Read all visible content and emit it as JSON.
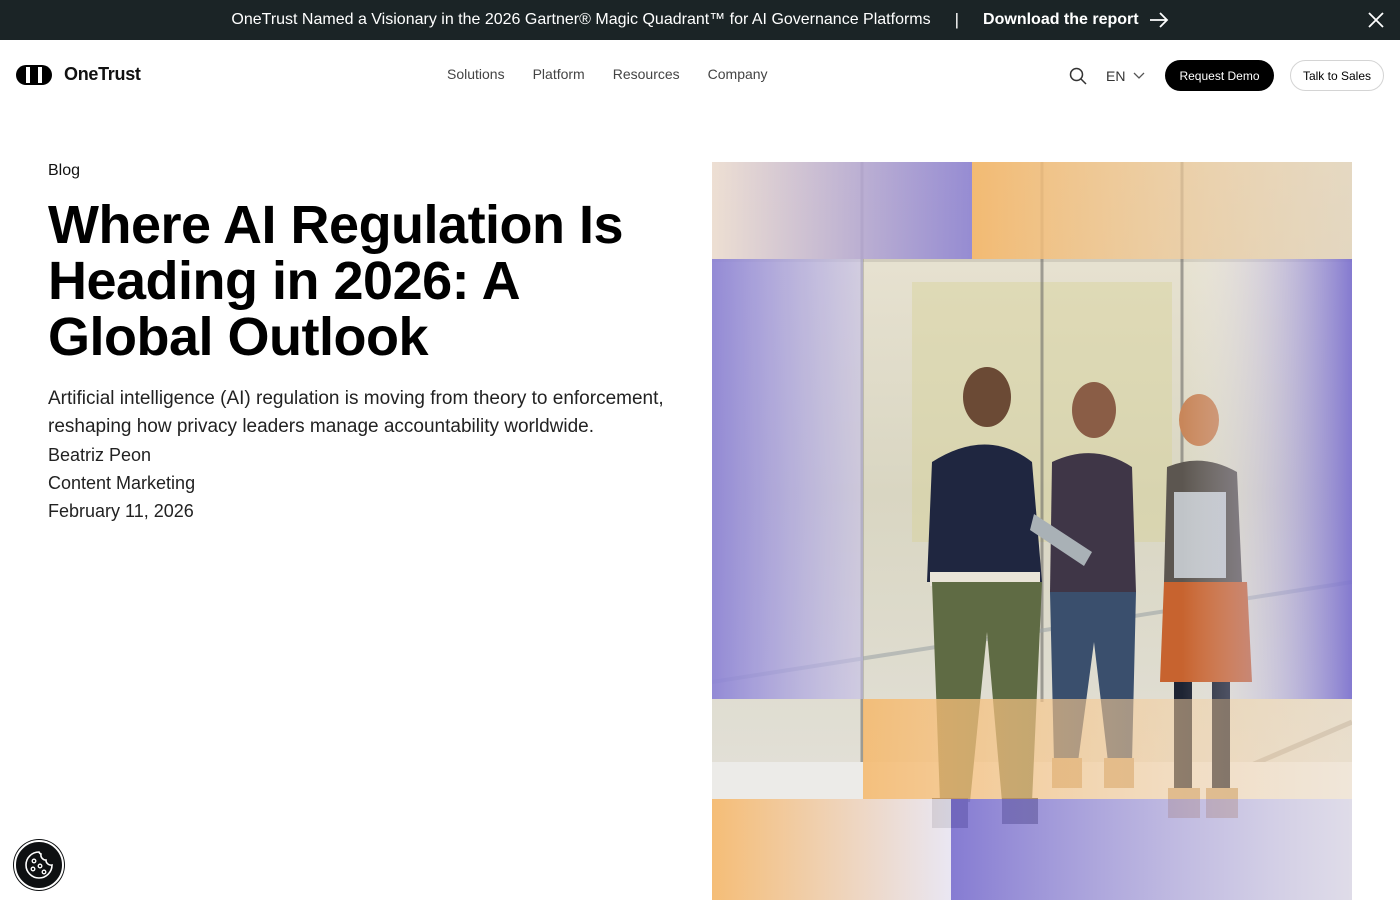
{
  "banner": {
    "message": "OneTrust Named a Visionary in the 2026 Gartner® Magic Quadrant™ for AI Governance Platforms",
    "separator": "|",
    "cta_label": "Download the report",
    "cta_icon": "arrow-right-icon",
    "close_icon": "close-icon"
  },
  "nav": {
    "logo_text": "OneTrust",
    "menu": [
      "Solutions",
      "Platform",
      "Resources",
      "Company"
    ],
    "search_icon": "search-icon",
    "language": "EN",
    "request_demo": "Request Demo",
    "talk_to_sales": "Talk to Sales"
  },
  "article": {
    "eyebrow": "Blog",
    "title": "Where AI Regulation Is Heading in 2026: A Global Outlook",
    "summary": "Artificial intelligence (AI) regulation is moving from theory to enforcement, reshaping how privacy leaders manage accountability worldwide.",
    "author": "Beatriz Peon",
    "author_role": "Content Marketing",
    "date": "February 11, 2026"
  },
  "hero_image": {
    "icon": "photo-three-people-with-tablet"
  },
  "cookie_settings": {
    "icon": "cookie-icon"
  },
  "colors": {
    "banner_bg": "#1b2426",
    "accent_purple": "#7a6fd0",
    "accent_orange": "#f6b86a",
    "button_dark": "#000000"
  }
}
